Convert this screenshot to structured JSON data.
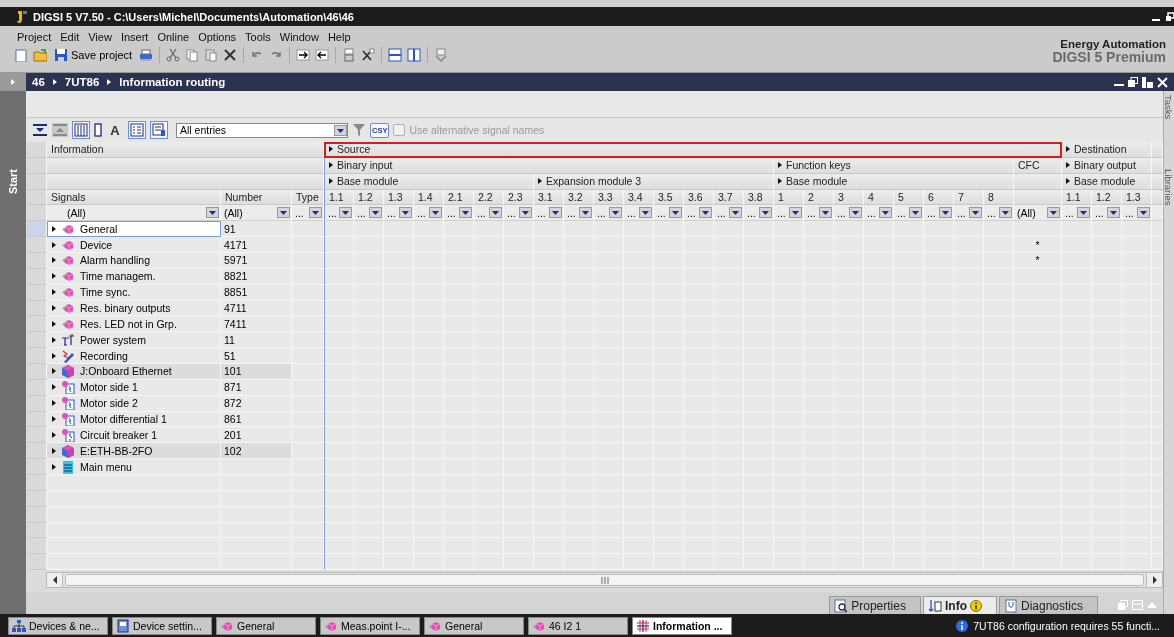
{
  "window": {
    "title": "DIGSI 5 V7.50  -  C:\\Users\\Michel\\Documents\\Automation\\46\\46"
  },
  "menu": [
    "Project",
    "Edit",
    "View",
    "Insert",
    "Online",
    "Options",
    "Tools",
    "Window",
    "Help"
  ],
  "toolbar": {
    "save_label": "Save project"
  },
  "brand": {
    "company": "Energy Automation",
    "product": "DIGSI 5 Premium"
  },
  "breadcrumb": [
    "46",
    "7UT86",
    "Information routing"
  ],
  "side": {
    "left": "Start",
    "right": [
      "Tasks",
      "Libraries"
    ]
  },
  "table_toolbar": {
    "font_button": "A",
    "entries_filter": "All entries",
    "csv_button": "CSY",
    "alt_names": {
      "label": "Use alternative signal names",
      "checked": false,
      "disabled": true
    }
  },
  "table": {
    "info_header": "Information",
    "info_columns": [
      {
        "label": "Signals",
        "filter": "(All)"
      },
      {
        "label": "Number",
        "filter": "(All)"
      },
      {
        "label": "Type",
        "filter": "..."
      }
    ],
    "groups": [
      {
        "label": "Source",
        "expanded": false,
        "highlighted": true,
        "children": [
          {
            "label": "Binary input",
            "expanded": false,
            "children": [
              {
                "label": "Base module",
                "expanded": false,
                "columns": [
                  {
                    "kind": "slot",
                    "label": "1.1",
                    "filter": "..."
                  },
                  {
                    "kind": "slot",
                    "label": "1.2",
                    "filter": "..."
                  },
                  {
                    "kind": "slot",
                    "label": "1.3",
                    "filter": "..."
                  },
                  {
                    "kind": "slot",
                    "label": "1.4",
                    "filter": "..."
                  },
                  {
                    "kind": "slot",
                    "label": "2.1",
                    "filter": "..."
                  },
                  {
                    "kind": "slot",
                    "label": "2.2",
                    "filter": "..."
                  },
                  {
                    "kind": "slot",
                    "label": "2.3",
                    "filter": "..."
                  }
                ]
              },
              {
                "label": "Expansion module 3",
                "expanded": false,
                "columns": [
                  {
                    "kind": "slot",
                    "label": "3.1",
                    "filter": "..."
                  },
                  {
                    "kind": "slot",
                    "label": "3.2",
                    "filter": "..."
                  },
                  {
                    "kind": "slot",
                    "label": "3.3",
                    "filter": "..."
                  },
                  {
                    "kind": "slot",
                    "label": "3.4",
                    "filter": "..."
                  },
                  {
                    "kind": "slot",
                    "label": "3.5",
                    "filter": "..."
                  },
                  {
                    "kind": "slot",
                    "label": "3.6",
                    "filter": "..."
                  },
                  {
                    "kind": "slot",
                    "label": "3.7",
                    "filter": "..."
                  },
                  {
                    "kind": "slot",
                    "label": "3.8",
                    "filter": "..."
                  }
                ]
              }
            ]
          },
          {
            "label": "Function keys",
            "expanded": false,
            "children": [
              {
                "label": "Base module",
                "expanded": false,
                "columns": [
                  {
                    "kind": "slot",
                    "label": "1",
                    "filter": "..."
                  },
                  {
                    "kind": "slot",
                    "label": "2",
                    "filter": "..."
                  },
                  {
                    "kind": "slot",
                    "label": "3",
                    "filter": "..."
                  },
                  {
                    "kind": "slot",
                    "label": "4",
                    "filter": "..."
                  },
                  {
                    "kind": "slot",
                    "label": "5",
                    "filter": "..."
                  },
                  {
                    "kind": "slot",
                    "label": "6",
                    "filter": "..."
                  },
                  {
                    "kind": "slot",
                    "label": "7",
                    "filter": "..."
                  },
                  {
                    "kind": "slot",
                    "label": "8",
                    "filter": "..."
                  }
                ]
              }
            ]
          },
          {
            "label": "CFC",
            "children": [
              {
                "columns": [
                  {
                    "kind": "cfc",
                    "filter": "(All)"
                  }
                ]
              }
            ]
          }
        ]
      },
      {
        "label": "Destination",
        "expanded": false,
        "highlighted": false,
        "children": [
          {
            "label": "Binary output",
            "expanded": false,
            "children": [
              {
                "label": "Base module",
                "expanded": false,
                "columns": [
                  {
                    "kind": "slot",
                    "label": "1.1",
                    "filter": "..."
                  },
                  {
                    "kind": "slot",
                    "label": "1.2",
                    "filter": "..."
                  },
                  {
                    "kind": "slot",
                    "label": "1.3",
                    "filter": "..."
                  }
                ]
              }
            ]
          }
        ]
      }
    ],
    "rows": [
      {
        "name": "General",
        "number": "91",
        "kind": "function",
        "expanded": false,
        "selected": true
      },
      {
        "name": "Device",
        "number": "4171",
        "kind": "function",
        "expanded": false,
        "selected": false,
        "cfc": "*"
      },
      {
        "name": "Alarm handling",
        "number": "5971",
        "kind": "function",
        "expanded": false,
        "selected": false,
        "cfc": "*"
      },
      {
        "name": "Time managem.",
        "number": "8821",
        "kind": "function",
        "expanded": false,
        "selected": false
      },
      {
        "name": "Time sync.",
        "number": "8851",
        "kind": "function",
        "expanded": false,
        "selected": false
      },
      {
        "name": "Res. binary outputs",
        "number": "4711",
        "kind": "function",
        "expanded": false,
        "selected": false
      },
      {
        "name": "Res. LED not in Grp.",
        "number": "7411",
        "kind": "function",
        "expanded": false,
        "selected": false
      },
      {
        "name": "Power system",
        "number": "11",
        "kind": "power",
        "expanded": false,
        "selected": false
      },
      {
        "name": "Recording",
        "number": "51",
        "kind": "recording",
        "expanded": false,
        "selected": false
      },
      {
        "name": "J:Onboard Ethernet",
        "number": "101",
        "kind": "module",
        "expanded": false,
        "selected": false
      },
      {
        "name": "Motor side 1",
        "number": "871",
        "kind": "function_group",
        "expanded": false,
        "selected": false
      },
      {
        "name": "Motor side 2",
        "number": "872",
        "kind": "function_group",
        "expanded": false,
        "selected": false
      },
      {
        "name": "Motor differential 1",
        "number": "861",
        "kind": "function_group",
        "expanded": false,
        "selected": false
      },
      {
        "name": "Circuit breaker 1",
        "number": "201",
        "kind": "breaker",
        "expanded": false,
        "selected": false
      },
      {
        "name": "E:ETH-BB-2FO",
        "number": "102",
        "kind": "module",
        "expanded": false,
        "selected": false
      },
      {
        "name": "Main menu",
        "kind": "menu",
        "expanded": false,
        "selected": false
      }
    ]
  },
  "bottom_tabs": [
    {
      "label": "Properties",
      "kind": "properties",
      "selected": false
    },
    {
      "label": "Info",
      "kind": "info",
      "selected": true
    },
    {
      "label": "Diagnostics",
      "kind": "diagnostics",
      "selected": false
    }
  ],
  "taskbar": [
    {
      "label": "Devices & ne...",
      "kind": "network",
      "selected": false
    },
    {
      "label": "Device settin...",
      "kind": "device",
      "selected": false
    },
    {
      "label": "General",
      "kind": "function",
      "selected": false
    },
    {
      "label": "Meas.point I-...",
      "kind": "function",
      "selected": false
    },
    {
      "label": "General",
      "kind": "function",
      "selected": false
    },
    {
      "label": "46 I2 1",
      "kind": "function",
      "selected": false
    },
    {
      "label": "Information ...",
      "kind": "grid",
      "selected": true
    }
  ],
  "status": "7UT86 configuration requires 55 functi..."
}
